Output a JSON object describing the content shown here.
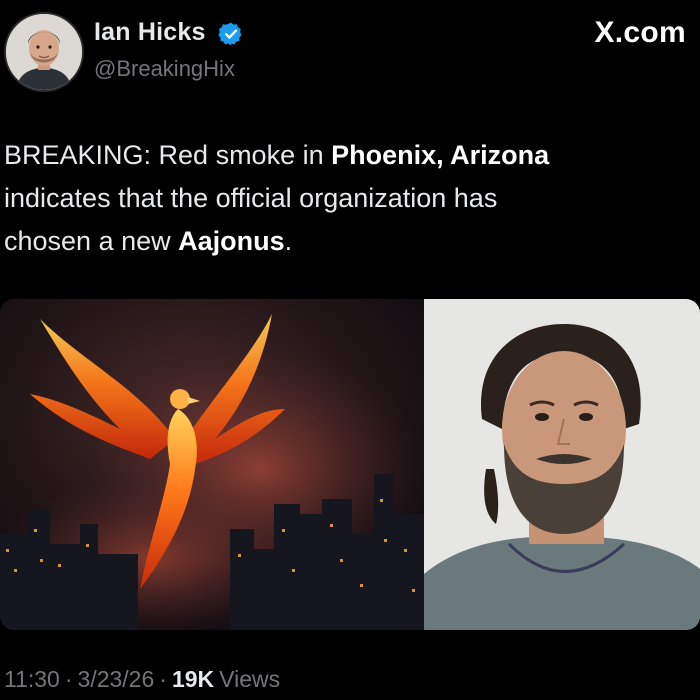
{
  "author": {
    "name": "Ian Hicks",
    "handle": "@BreakingHix",
    "verified_color": "#1d9bf0"
  },
  "brand": "X.com",
  "tweet": {
    "line1_prefix": "BREAKING: Red smoke in ",
    "line1_bold": "Phoenix, Arizona",
    "line2": "indicates that the official organization has",
    "line3_prefix": "chosen a new ",
    "line3_bold": "Aajonus",
    "line3_suffix": "."
  },
  "media": [
    {
      "description_icon": "phoenix-over-city-image"
    },
    {
      "description_icon": "bearded-man-portrait-image"
    }
  ],
  "meta": {
    "time": "11:30",
    "separator": "·",
    "date": "3/23/26",
    "views_count": "19K",
    "views_label": "Views"
  },
  "colors": {
    "background": "#000000",
    "text": "#e7e9ea",
    "muted": "#71767b"
  }
}
